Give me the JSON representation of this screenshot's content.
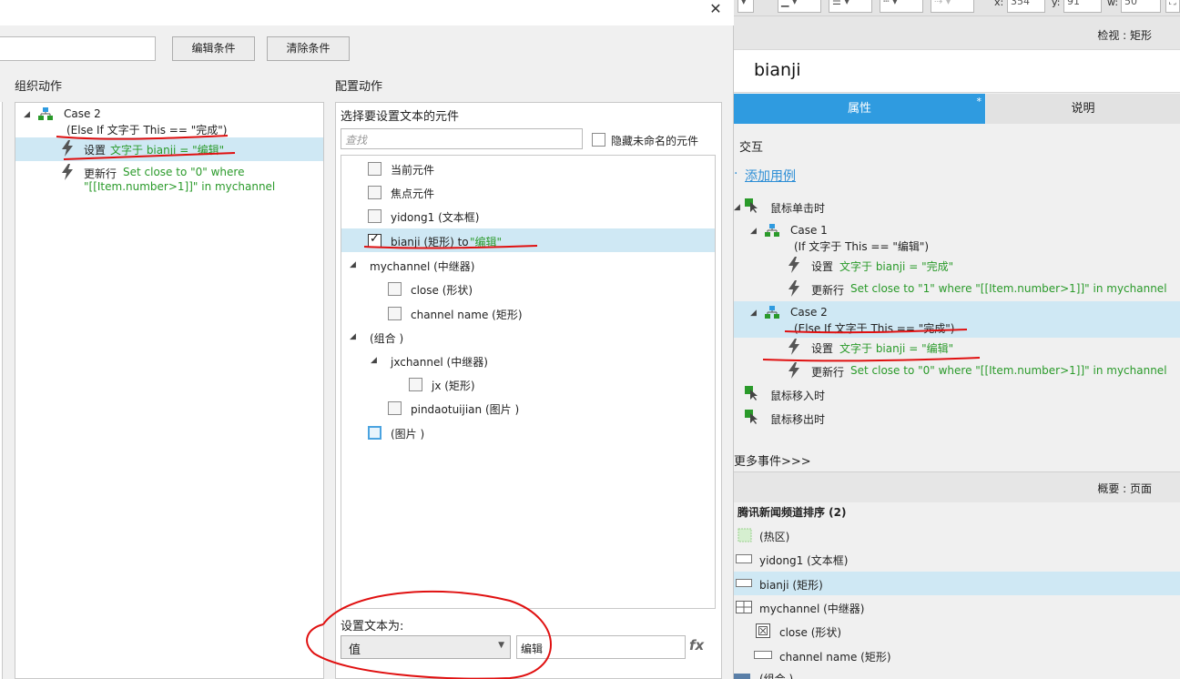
{
  "dialog": {
    "close": "✕",
    "edit_condition": "编辑条件",
    "clear_condition": "清除条件",
    "organize_title": "组织动作",
    "configure_title": "配置动作"
  },
  "organize": {
    "case_label": "Case 2",
    "case_condition": "(Else If 文字于 This == \"完成\")",
    "action1_verb": "设置",
    "action1_detail": "文字于 bianji = \"编辑\"",
    "action2_verb": "更新行",
    "action2_detail_line1": "Set close to \"0\" where",
    "action2_detail_line2": "\"[[Item.number>1]]\" in mychannel"
  },
  "configure": {
    "subtitle": "选择要设置文本的元件",
    "search_placeholder": "查找",
    "hide_unnamed": "隐藏未命名的元件",
    "items": [
      {
        "label": "当前元件",
        "checked": false
      },
      {
        "label": "焦点元件",
        "checked": false
      },
      {
        "label": "yidong1 (文本框)",
        "checked": false
      },
      {
        "label": "bianji (矩形) to",
        "suffix": "\"编辑\"",
        "checked": true
      },
      {
        "label": "mychannel (中继器)"
      },
      {
        "label": "close (形状)",
        "checked": false
      },
      {
        "label": "channel name (矩形)",
        "checked": false
      },
      {
        "label": "(组合 )"
      },
      {
        "label": "jxchannel (中继器)"
      },
      {
        "label": "jx (矩形)",
        "checked": false
      },
      {
        "label": "pindaotuijian (图片 )",
        "checked": false
      },
      {
        "label": "(图片 )",
        "checked": false
      }
    ],
    "set_text_label": "设置文本为:",
    "value_type": "值",
    "value_text": "编辑",
    "fx": "fx"
  },
  "toolbar": {
    "x_label": "x:",
    "x_value": "354",
    "y_label": "y:",
    "y_value": "91",
    "w_label": "w:",
    "w_value": "50"
  },
  "inspector": {
    "title": "检视 : 矩形",
    "widget_name": "bianji",
    "tab_properties": "属性",
    "tab_star": "*",
    "tab_notes": "说明",
    "interaction_title": "交互",
    "add_case": "添加用例",
    "event_click": "鼠标单击时",
    "case1_label": "Case 1",
    "case1_condition": "(If 文字于 This == \"编辑\")",
    "case1_a1_verb": "设置",
    "case1_a1_detail": "文字于 bianji = \"完成\"",
    "case1_a2_verb": "更新行",
    "case1_a2_detail": "Set close to \"1\" where \"[[Item.number>1]]\" in mychannel",
    "case2_label": "Case 2",
    "case2_condition": "(Else If 文字于 This == \"完成\")",
    "case2_a1_verb": "设置",
    "case2_a1_detail": "文字于 bianji = \"编辑\"",
    "case2_a2_verb": "更新行",
    "case2_a2_detail": "Set close to \"0\" where \"[[Item.number>1]]\" in mychannel",
    "event_enter": "鼠标移入时",
    "event_leave": "鼠标移出时",
    "more_events": "更多事件>>>"
  },
  "outline": {
    "title": "概要 : 页面",
    "page_name": "腾讯新闻频道排序 (2)",
    "items": [
      "(热区)",
      "yidong1 (文本框)",
      "bianji (矩形)",
      "mychannel (中继器)",
      "close (形状)",
      "channel name (矩形)",
      "(组合 )"
    ]
  },
  "colors": {
    "accent": "#2f9be0",
    "selection": "#cfe8f4",
    "action_green": "#2a9a2a",
    "annotation_red": "#e01010"
  }
}
